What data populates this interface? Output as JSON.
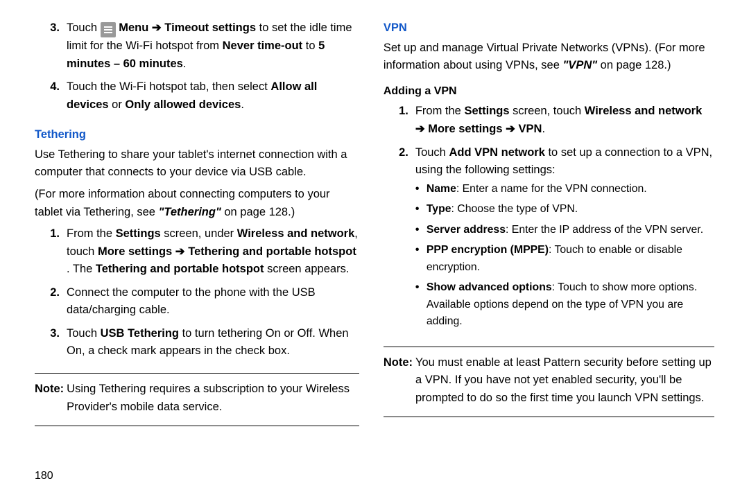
{
  "left": {
    "step3": {
      "num": "3.",
      "pre": "Touch ",
      "b1": "Menu ➔ Timeout settings",
      "mid1": " to set the idle time limit for the Wi-Fi hotspot from ",
      "b2": "Never time-out",
      "mid2": " to ",
      "b3": "5 minutes – 60 minutes",
      "end": "."
    },
    "step4": {
      "num": "4.",
      "pre": "Touch the Wi-Fi hotspot tab, then select ",
      "b1": "Allow all devices",
      "mid": " or ",
      "b2": "Only allowed devices",
      "end": "."
    },
    "tethering_heading": "Tethering",
    "tethering_para1": "Use Tethering to share your tablet's internet connection with a computer that connects to your device via USB cable.",
    "tethering_para2a": "(For more information about connecting computers to your tablet via Tethering, see ",
    "tethering_para2b": "\"Tethering\"",
    "tethering_para2c": " on page 128.)",
    "t_step1": {
      "num": "1.",
      "pre": "From the ",
      "b1": "Settings",
      "mid1": " screen, under ",
      "b2": "Wireless and network",
      "mid2": ", touch ",
      "b3": "More settings ➔ Tethering and portable hotspot",
      "mid3": " . The ",
      "b4": "Tethering and portable hotspot",
      "end": " screen appears."
    },
    "t_step2": {
      "num": "2.",
      "text": "Connect the computer to the phone with the USB data/charging cable."
    },
    "t_step3": {
      "num": "3.",
      "pre": "Touch ",
      "b1": "USB Tethering",
      "end": " to turn tethering On or Off. When On, a check mark appears in the check box."
    },
    "note_label": "Note: ",
    "note_text": "Using Tethering requires a subscription to your Wireless Provider's mobile data service.",
    "page_number": "180"
  },
  "right": {
    "vpn_heading": "VPN",
    "vpn_para_a": "Set up and manage Virtual Private Networks (VPNs).  (For more information about using VPNs, see ",
    "vpn_para_b": "\"VPN\"",
    "vpn_para_c": " on page 128.)",
    "adding_heading": "Adding a VPN",
    "v_step1": {
      "num": "1.",
      "pre": "From the ",
      "b1": "Settings",
      "mid1": " screen, touch ",
      "b2": "Wireless and network ➔ More settings ➔ VPN",
      "end": "."
    },
    "v_step2": {
      "num": "2.",
      "pre": "Touch ",
      "b1": "Add VPN network",
      "end": " to set up a connection to a VPN, using the following settings:"
    },
    "bullets": {
      "a": {
        "b": "Name",
        "t": ": Enter a name for the VPN connection."
      },
      "b": {
        "b": "Type",
        "t": ": Choose the type of VPN."
      },
      "c": {
        "b": "Server address",
        "t": ": Enter the IP address of the VPN server."
      },
      "d": {
        "b": "PPP encryption (MPPE)",
        "t": ": Touch to enable or disable encryption."
      },
      "e": {
        "b": "Show advanced options",
        "t": ": Touch to show more options. Available options depend on the type of VPN you are adding."
      }
    },
    "note_label": "Note: ",
    "note_text": "You must enable at least Pattern security before setting up a VPN. If you have not yet enabled security, you'll be prompted to do so the first time you launch VPN settings."
  }
}
